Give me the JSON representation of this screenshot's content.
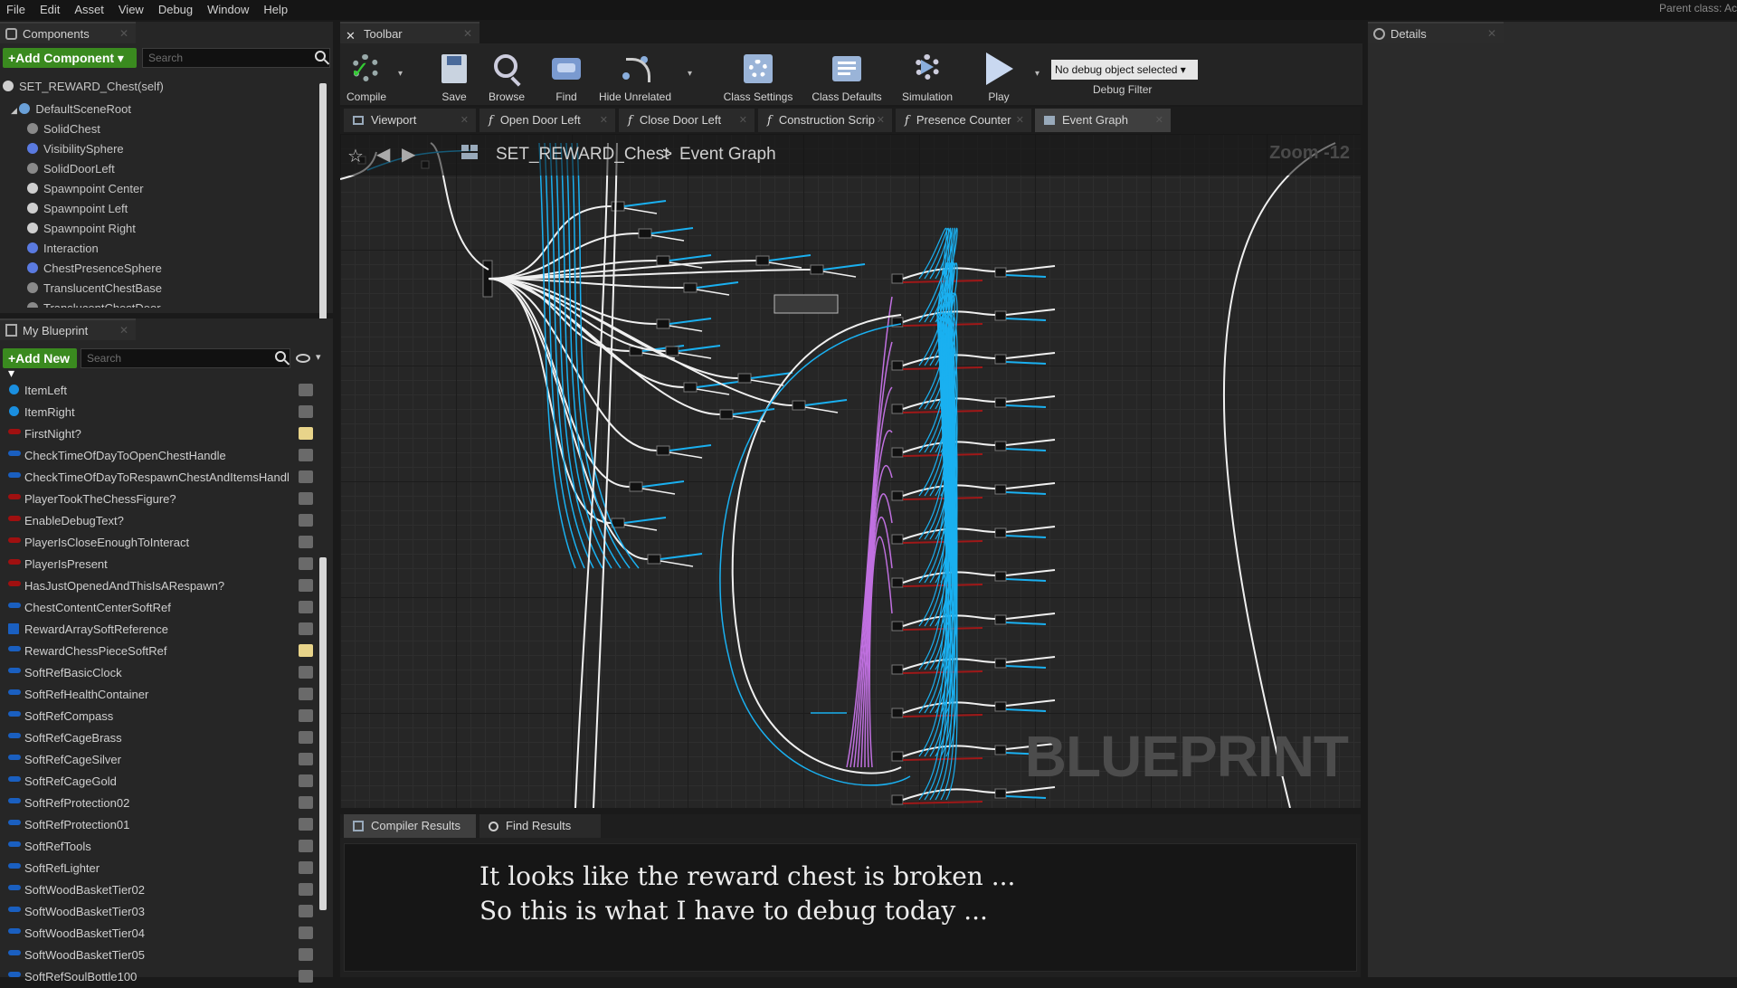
{
  "menu": [
    "File",
    "Edit",
    "Asset",
    "View",
    "Debug",
    "Window",
    "Help"
  ],
  "parent_class": "Parent class: Ac",
  "components": {
    "tab": "Components",
    "add_button": "+Add Component ▾",
    "search_placeholder": "Search",
    "self": "SET_REWARD_Chest(self)",
    "items": [
      {
        "label": "DefaultSceneRoot",
        "color": "#6aa0d8"
      },
      {
        "label": "SolidChest",
        "color": "#8a8a8a"
      },
      {
        "label": "VisibilitySphere",
        "color": "#5a7ae0"
      },
      {
        "label": "SolidDoorLeft",
        "color": "#8a8a8a"
      },
      {
        "label": "Spawnpoint Center",
        "color": "#cfcfcf"
      },
      {
        "label": "Spawnpoint Left",
        "color": "#cfcfcf"
      },
      {
        "label": "Spawnpoint Right",
        "color": "#cfcfcf"
      },
      {
        "label": "Interaction",
        "color": "#5a7ae0"
      },
      {
        "label": "ChestPresenceSphere",
        "color": "#5a7ae0"
      },
      {
        "label": "TranslucentChestBase",
        "color": "#8a8a8a"
      },
      {
        "label": "TranslucentChestDoor",
        "color": "#8a8a8a"
      }
    ]
  },
  "my_blueprint": {
    "tab": "My Blueprint",
    "add_button": "+Add New ▾",
    "search_placeholder": "Search",
    "variables": [
      {
        "name": "ItemLeft",
        "color": "#1a8fe0",
        "pin": "round",
        "eye": false
      },
      {
        "name": "ItemRight",
        "color": "#1a8fe0",
        "pin": "round",
        "eye": false
      },
      {
        "name": "FirstNight?",
        "color": "#a01010",
        "pin": "bar",
        "eye": true
      },
      {
        "name": "CheckTimeOfDayToOpenChestHandle",
        "color": "#1a5fc0",
        "pin": "bar",
        "eye": false
      },
      {
        "name": "CheckTimeOfDayToRespawnChestAndItemsHandl",
        "color": "#1a5fc0",
        "pin": "bar",
        "eye": false
      },
      {
        "name": "PlayerTookTheChessFigure?",
        "color": "#a01010",
        "pin": "bar",
        "eye": false
      },
      {
        "name": "EnableDebugText?",
        "color": "#a01010",
        "pin": "bar",
        "eye": false
      },
      {
        "name": "PlayerIsCloseEnoughToInteract",
        "color": "#a01010",
        "pin": "bar",
        "eye": false
      },
      {
        "name": "PlayerIsPresent",
        "color": "#a01010",
        "pin": "bar",
        "eye": false
      },
      {
        "name": "HasJustOpenedAndThisIsARespawn?",
        "color": "#a01010",
        "pin": "bar",
        "eye": false
      },
      {
        "name": "ChestContentCenterSoftRef",
        "color": "#1a5fc0",
        "pin": "bar",
        "eye": false
      },
      {
        "name": "RewardArraySoftReference",
        "color": "#1a5fc0",
        "pin": "grid",
        "eye": false
      },
      {
        "name": "RewardChessPieceSoftRef",
        "color": "#1a5fc0",
        "pin": "bar",
        "eye": true
      },
      {
        "name": "SoftRefBasicClock",
        "color": "#1a5fc0",
        "pin": "bar",
        "eye": false
      },
      {
        "name": "SoftRefHealthContainer",
        "color": "#1a5fc0",
        "pin": "bar",
        "eye": false
      },
      {
        "name": "SoftRefCompass",
        "color": "#1a5fc0",
        "pin": "bar",
        "eye": false
      },
      {
        "name": "SoftRefCageBrass",
        "color": "#1a5fc0",
        "pin": "bar",
        "eye": false
      },
      {
        "name": "SoftRefCageSilver",
        "color": "#1a5fc0",
        "pin": "bar",
        "eye": false
      },
      {
        "name": "SoftRefCageGold",
        "color": "#1a5fc0",
        "pin": "bar",
        "eye": false
      },
      {
        "name": "SoftRefProtection02",
        "color": "#1a5fc0",
        "pin": "bar",
        "eye": false
      },
      {
        "name": "SoftRefProtection01",
        "color": "#1a5fc0",
        "pin": "bar",
        "eye": false
      },
      {
        "name": "SoftRefTools",
        "color": "#1a5fc0",
        "pin": "bar",
        "eye": false
      },
      {
        "name": "SoftRefLighter",
        "color": "#1a5fc0",
        "pin": "bar",
        "eye": false
      },
      {
        "name": "SoftWoodBasketTier02",
        "color": "#1a5fc0",
        "pin": "bar",
        "eye": false
      },
      {
        "name": "SoftWoodBasketTier03",
        "color": "#1a5fc0",
        "pin": "bar",
        "eye": false
      },
      {
        "name": "SoftWoodBasketTier04",
        "color": "#1a5fc0",
        "pin": "bar",
        "eye": false
      },
      {
        "name": "SoftWoodBasketTier05",
        "color": "#1a5fc0",
        "pin": "bar",
        "eye": false
      },
      {
        "name": "SoftRefSoulBottle100",
        "color": "#1a5fc0",
        "pin": "bar",
        "eye": false
      }
    ]
  },
  "toolbar": {
    "tab": "Toolbar",
    "buttons": [
      {
        "label": "Compile",
        "icon": "compile-icon"
      },
      {
        "label": "Save",
        "icon": "save-icon"
      },
      {
        "label": "Browse",
        "icon": "browse-icon"
      },
      {
        "label": "Find",
        "icon": "find-icon"
      },
      {
        "label": "Hide Unrelated",
        "icon": "hide-unrelated-icon"
      },
      {
        "label": "Class Settings",
        "icon": "class-settings-icon"
      },
      {
        "label": "Class Defaults",
        "icon": "class-defaults-icon"
      },
      {
        "label": "Simulation",
        "icon": "simulation-icon"
      },
      {
        "label": "Play",
        "icon": "play-icon"
      }
    ],
    "debug_object": "No debug object selected ▾",
    "debug_filter": "Debug Filter"
  },
  "graph_tabs": [
    {
      "label": "Viewport",
      "type": "viewport"
    },
    {
      "label": "Open Door Left",
      "type": "function"
    },
    {
      "label": "Close Door Left",
      "type": "function"
    },
    {
      "label": "Construction Scrip",
      "type": "function"
    },
    {
      "label": "Presence Counter",
      "type": "function"
    },
    {
      "label": "Event Graph",
      "type": "graph",
      "active": true
    }
  ],
  "graph": {
    "breadcrumb_root": "SET_REWARD_Chest",
    "breadcrumb_sep": ">",
    "breadcrumb_leaf": "Event Graph",
    "zoom": "Zoom -12",
    "watermark": "BLUEPRINT"
  },
  "bottom_tabs": [
    "Compiler Results",
    "Find Results"
  ],
  "caption": {
    "line1": "It looks like the reward chest is broken ...",
    "line2": "So this is what I have to debug today ..."
  },
  "details": {
    "tab": "Details"
  },
  "colors": {
    "exec_wire": "#f0f0f0",
    "object_wire": "#1ab0f0",
    "bool_wire": "#a01818",
    "class_wire": "#c070e0",
    "accent_green": "#3a8a1f"
  }
}
